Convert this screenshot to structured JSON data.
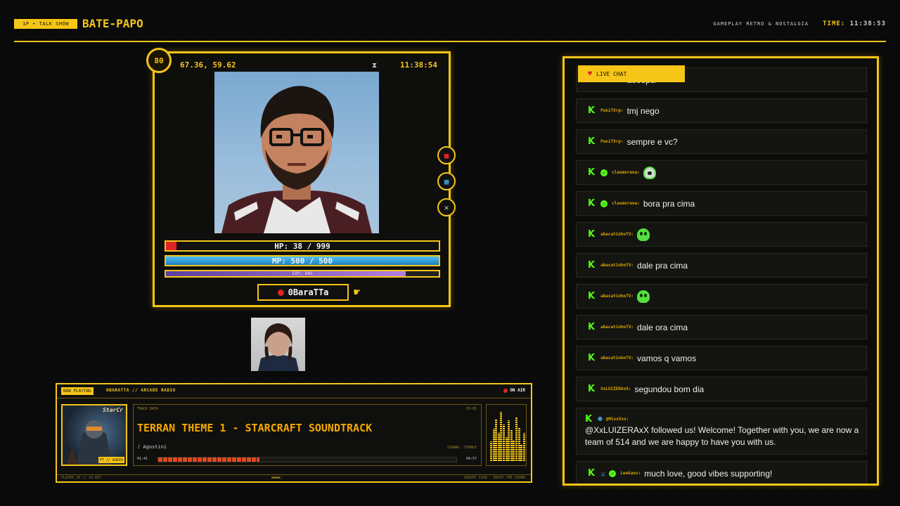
{
  "topbar": {
    "tag": "1P • TALK SHOW",
    "brand": "BATE-PAPO",
    "subtitle": "GAMEPLAY RETRO & NOSTALGIA",
    "time_label": "TIME:",
    "time_value": "11:38:53"
  },
  "panel": {
    "level": "80",
    "coords": "67.36, 59.62",
    "time": "11:38:54",
    "hp_text": "HP: 38 / 999",
    "hp_fraction": 0.038,
    "mp_text": "MP: 500 / 500",
    "mp_fraction": 1.0,
    "exp_text": "EXP: 88%",
    "exp_fraction": 0.88,
    "name": "0BaraTTa",
    "icons": [
      "record-icon",
      "map-icon",
      "close-icon"
    ]
  },
  "now_playing": {
    "badge": "NOW PLAYING",
    "source": "0BARATTA // ARCADE RADIO",
    "status": "ON AIR",
    "cover_title": "StarCr",
    "cover_badge": "FT // AUDIO",
    "track_label": "TRACK DATA",
    "channel": "CH-01",
    "title": "TERRAN THEME 1 - STARCRAFT SOUNDTRACK",
    "artist": "♪ Agostini",
    "signal": "SIGNAL: STABLE",
    "time_current": "01:41",
    "time_total": "04:57",
    "progress": 0.34,
    "footer_left": "PLAYER_1B // 16 BIT",
    "footer_center": "●●●●○",
    "footer_right": "INSERT COIN · ENJOY THE SOUND"
  },
  "chat": {
    "title": "LIVE CHAT",
    "messages": [
      {
        "user": "PuniTVrp:",
        "text": "aooopa",
        "verified": false
      },
      {
        "user": "PuniTVrp:",
        "text": "tmj nego",
        "verified": false
      },
      {
        "user": "PuniTVrp:",
        "text": "sempre e vc?",
        "verified": false
      },
      {
        "user": "claumorena:",
        "text": "",
        "verified": true,
        "emote": "skull-emote"
      },
      {
        "user": "claumorena:",
        "text": "bora pra cima",
        "verified": true
      },
      {
        "user": "abacatinhoTV:",
        "text": "",
        "verified": false,
        "emote": "ghost-emote"
      },
      {
        "user": "abacatinhoTV:",
        "text": "dale pra cima",
        "verified": false
      },
      {
        "user": "abacatinhoTV:",
        "text": "",
        "verified": false,
        "emote": "ghost-emote"
      },
      {
        "user": "abacatinhoTV:",
        "text": "dale ora cima",
        "verified": false
      },
      {
        "user": "abacatinhoTV:",
        "text": "vamos q vamos",
        "verified": false
      },
      {
        "user": "XxLUIZERAxX:",
        "text": "segundou bom dia",
        "verified": false
      },
      {
        "user": "@MissXss:",
        "text": "@XxLUIZERAxX followed us! Welcome! Together with you, we are now a team of 514 and we are happy to have you with us.",
        "verified": false,
        "bot": true
      },
      {
        "user": "Leokaos:",
        "text": "much love, good vibes supporting!",
        "verified": true,
        "sword": true
      }
    ]
  }
}
